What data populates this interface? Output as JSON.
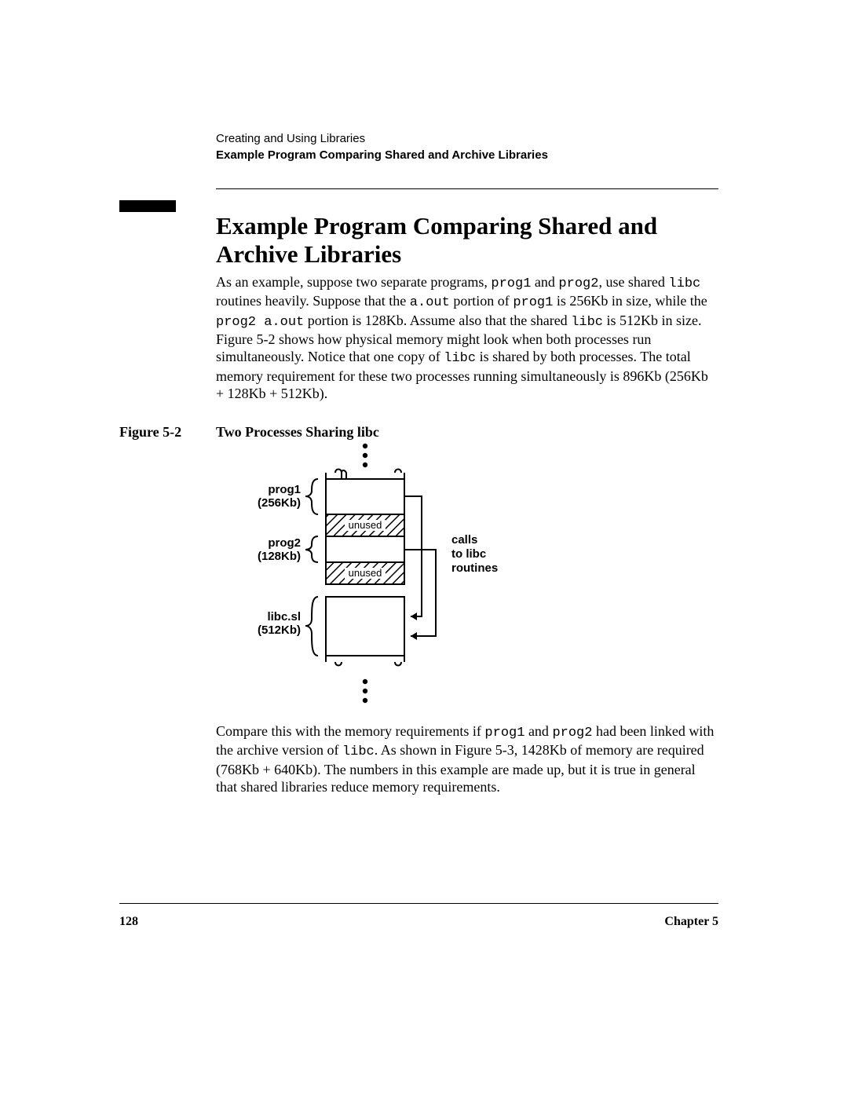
{
  "header": {
    "chapter_title": "Creating and Using Libraries",
    "section_title": "Example Program Comparing Shared and Archive Libraries"
  },
  "title": "Example Program Comparing Shared and Archive Libraries",
  "para1": {
    "t1": "As an example, suppose two separate programs, ",
    "c1": "prog1",
    "t2": " and ",
    "c2": "prog2",
    "t3": ", use shared ",
    "c3": "libc",
    "t4": " routines heavily. Suppose that the ",
    "c4": "a.out",
    "t5": " portion of ",
    "c5": "prog1",
    "t6": " is 256Kb in size, while the ",
    "c6": "prog2 a.out",
    "t7": " portion is 128Kb. Assume also that the shared ",
    "c7": "libc",
    "t8": " is 512Kb in size. Figure 5-2 shows how physical memory might look when both processes run simultaneously. Notice that one copy of ",
    "c8": "libc",
    "t9": " is shared by both processes. The total memory requirement for these two processes running simultaneously is 896Kb (256Kb + 128Kb + 512Kb)."
  },
  "figure": {
    "label": "Figure 5-2",
    "caption": "Two Processes Sharing libc",
    "labels": {
      "prog1": "prog1",
      "prog1_size": "(256Kb)",
      "prog2": "prog2",
      "prog2_size": "(128Kb)",
      "libc": "libc.sl",
      "libc_size": "(512Kb)",
      "unused": "unused",
      "calls1": "calls",
      "calls2": "to   libc",
      "calls3": "routines"
    }
  },
  "para2": {
    "t1": "Compare this with the memory requirements if ",
    "c1": "prog1",
    "t2": " and ",
    "c2": "prog2",
    "t3": " had been linked with the archive version of ",
    "c3": "libc",
    "t4": ". As shown in Figure 5-3, 1428Kb of memory are required (768Kb + 640Kb). The numbers in this example are made up, but it is true in general that shared libraries reduce memory requirements."
  },
  "footer": {
    "page": "128",
    "chapter": "Chapter 5"
  }
}
